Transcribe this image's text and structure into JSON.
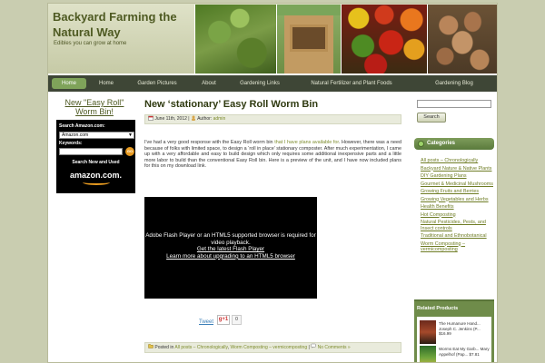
{
  "site": {
    "title": "Backyard Farming the Natural Way",
    "description": "Edibles you can grow at home"
  },
  "nav": [
    "Home",
    "Home",
    "Garden Pictures",
    "About",
    "Gardening Links",
    "Natural Fertilizer and Plant Foods",
    "Gardening Blog"
  ],
  "left_sidebar": {
    "amazon_title": "New \"Easy Roll\" Worm Bin!",
    "amazon_search_label": "Search Amazon.com:",
    "amazon_select_value": "Amazon.com",
    "amazon_keywords_label": "Keywords:",
    "amazon_go": "GO",
    "amazon_promo": "Search New and Used",
    "amazon_logo": "amazon.com."
  },
  "post": {
    "title": "New ‘stationary’ Easy Roll Worm Bin",
    "date": "June 11th, 2012",
    "author_label": "Author:",
    "author": "admin",
    "body_before_link": "I've had a very good response with the Easy Roll worm bin ",
    "body_link": "that I have plans available for",
    "body_after_link": ".  However, there was a need because of folks with limited space, to design a ‘roll in place’ stationary composter.  After much experimentation, I came up with a very affordable and easy to build design which only requires some additional inexpensive parts and a little more labor to build than the conventional Easy Roll bin. Here is a preview of the unit, and I have now included plans for this on my download link.",
    "video_message": "Adobe Flash Player or an HTML5 supported browser is required for video playback.",
    "video_link1": "Get the latest Flash Player",
    "video_link2": "Learn more about upgrading to an HTML5 browser",
    "tweet": "Tweet",
    "gplus": "g+1",
    "gplus_count": "0",
    "posted_in_label": "Posted in",
    "category1": "All posts – Chronologically",
    "category2": "Worm Composting – vermicomposting",
    "comments": "No Comments »"
  },
  "right_sidebar": {
    "search_button": "Search",
    "categories_title": "Categories",
    "categories": [
      "All posts – Chronologically",
      "Backyard Nature & Native Plants",
      "DIY Gardening Plans",
      "Gourmet & Medicinal Mushrooms",
      "Growing Fruits and Berries",
      "Growing Vegetables and Herbs",
      "Health Benefits",
      "Hot Composting",
      "Natural Pesticides, Pests, and Insect controls",
      "Traditional and Ethnobotanical",
      "Worm Composting – vermicomposting"
    ],
    "related_title": "Related Products",
    "related_products": [
      "The Humanure Hand... Joseph C. Jenkins (P... $16.99",
      "Worms Eat My Garb... Mary Appelhof (Pap... $7.81"
    ]
  },
  "colors": {
    "title_green": "#4e5a22",
    "nav_bg": "#3e4636",
    "link_green": "#7c8b2c",
    "category_header": "#6b8a4a"
  }
}
